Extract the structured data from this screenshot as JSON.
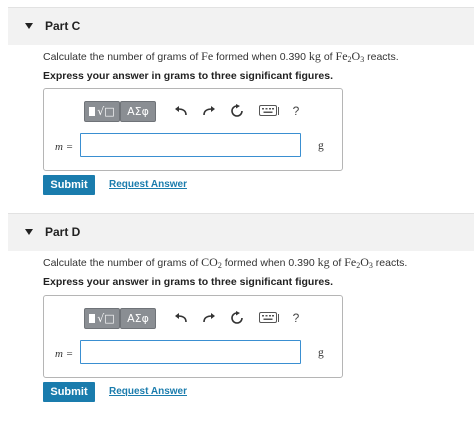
{
  "parts": [
    {
      "title": "Part C",
      "question": {
        "before": "Calculate the number of grams of",
        "substance": "Fe",
        "middle": "formed when 0.390",
        "mass_unit": "kg",
        "of": "of",
        "reactant": {
          "el1": "Fe",
          "sub1": "2",
          "el2": "O",
          "sub2": "3"
        },
        "after": "reacts."
      },
      "instruction": "Express your answer in grams to three significant figures.",
      "variable": "m =",
      "input_value": "",
      "unit": "g",
      "submit_label": "Submit",
      "request_label": "Request Answer"
    },
    {
      "title": "Part D",
      "question": {
        "before": "Calculate the number of grams of",
        "substance_el": "CO",
        "substance_sub": "2",
        "middle": "formed when 0.390",
        "mass_unit": "kg",
        "of": "of",
        "reactant": {
          "el1": "Fe",
          "sub1": "2",
          "el2": "O",
          "sub2": "3"
        },
        "after": "reacts."
      },
      "instruction": "Express your answer in grams to three significant figures.",
      "variable": "m =",
      "input_value": "",
      "unit": "g",
      "submit_label": "Submit",
      "request_label": "Request Answer"
    }
  ],
  "toolbar": {
    "symbols_label": "ΑΣφ",
    "templates_icon": "templates-icon",
    "undo_icon": "undo-icon",
    "redo_icon": "redo-icon",
    "reset_icon": "reset-icon",
    "keyboard_icon": "keyboard-icon",
    "help_label": "?"
  },
  "colors": {
    "accent": "#1a7cad",
    "header_bg": "#f2f2f2",
    "toolbar_button": "#8a8e93",
    "input_border": "#3a8fd1"
  }
}
